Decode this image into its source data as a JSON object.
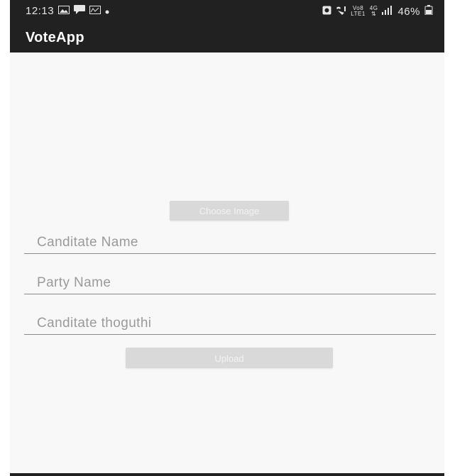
{
  "status_bar": {
    "time": "12:13",
    "left_icons": [
      "image-icon",
      "message-icon",
      "notification-icon",
      "dot-icon"
    ],
    "right_icons": [
      "alarm-icon",
      "wifi-calling-icon",
      "volte-icon",
      "data-arrows-icon",
      "signal-icon",
      "battery-icon"
    ],
    "volte_top": "Vo8",
    "volte_bottom": "LTE1",
    "data_top": "4G",
    "battery": "46%"
  },
  "app_bar": {
    "title": "VoteApp"
  },
  "form": {
    "choose_image_label": "Choose Image",
    "candidate_name_placeholder": "Canditate Name",
    "party_name_placeholder": "Party Name",
    "candidate_constituency_placeholder": "Canditate thoguthi",
    "upload_label": "Upload"
  },
  "colors": {
    "app_bar": "#212121",
    "background": "#f8f8f8",
    "button": "#d9d9d9",
    "hint_text": "#9a9a9a"
  }
}
